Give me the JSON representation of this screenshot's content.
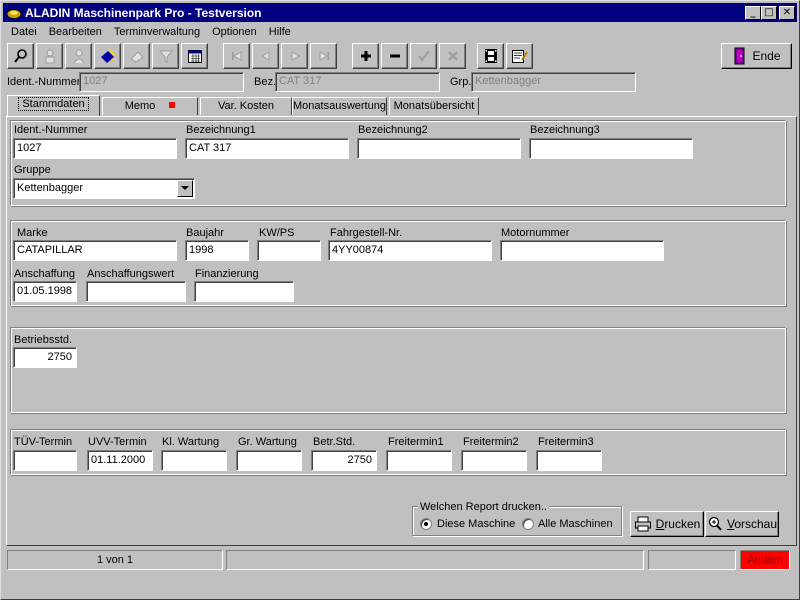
{
  "window": {
    "title": "ALADIN Maschinenpark Pro - Testversion",
    "min_glyph": "_",
    "max_glyph": "□",
    "close_glyph": "✕"
  },
  "menu": [
    {
      "label": "Datei"
    },
    {
      "label": "Bearbeiten"
    },
    {
      "label": "Terminverwaltung"
    },
    {
      "label": "Optionen"
    },
    {
      "label": "Hilfe"
    }
  ],
  "toolbar": {
    "icons": [
      "search-icon",
      "find-person-icon",
      "person-icon",
      "edit-note-icon",
      "eraser-icon",
      "filter-icon",
      "calendar-icon",
      "first-record-icon",
      "previous-record-icon",
      "next-record-icon",
      "last-record-icon",
      "add-icon",
      "remove-icon",
      "confirm-icon",
      "cancel-icon",
      "film-icon",
      "notepad-icon"
    ],
    "ende_label": "Ende"
  },
  "header": {
    "ident_label": "Ident.-Nummer",
    "ident_value": "1027",
    "bez_label": "Bez.",
    "bez_value": "CAT 317",
    "grp_label": "Grp.",
    "grp_value": "Kettenbagger"
  },
  "tabs": [
    {
      "label": "Stammdaten",
      "active": true
    },
    {
      "label": "Memo"
    },
    {
      "label": "Var. Kosten"
    },
    {
      "label": "Monatsauswertung"
    },
    {
      "label": "Monatsübersicht"
    }
  ],
  "stammdaten": {
    "ident_label": "Ident.-Nummer",
    "ident_value": "1027",
    "bez1_label": "Bezeichnung1",
    "bez1_value": "CAT 317",
    "bez2_label": "Bezeichnung2",
    "bez2_value": "",
    "bez3_label": "Bezeichnung3",
    "bez3_value": "",
    "gruppe_label": "Gruppe",
    "gruppe_value": "Kettenbagger",
    "marke_label": "Marke",
    "marke_value": "CATAPILLAR",
    "baujahr_label": "Baujahr",
    "baujahr_value": "1998",
    "kwps_label": "KW/PS",
    "kwps_value": "",
    "fahrgestell_label": "Fahrgestell-Nr.",
    "fahrgestell_value": "4YY00874",
    "motornummer_label": "Motornummer",
    "motornummer_value": "",
    "anschaffung_label": "Anschaffung",
    "anschaffung_value": "01.05.1998",
    "anschaffungswert_label": "Anschaffungswert",
    "anschaffungswert_value": "",
    "finanzierung_label": "Finanzierung",
    "finanzierung_value": "",
    "betriebsstd_label": "Betriebsstd.",
    "betriebsstd_value": "2750",
    "tuev_label": "TÜV-Termin",
    "tuev_value": "",
    "uvv_label": "UVV-Termin",
    "uvv_value": "01.11.2000",
    "klwartung_label": "Kl. Wartung",
    "klwartung_value": "",
    "grwartung_label": "Gr. Wartung",
    "grwartung_value": "",
    "betrstd_label": "Betr.Std.",
    "betrstd_value": "2750",
    "frei1_label": "Freitermin1",
    "frei1_value": "",
    "frei2_label": "Freitermin2",
    "frei2_value": "",
    "frei3_label": "Freitermin3",
    "frei3_value": ""
  },
  "report": {
    "legend": "Welchen Report drucken..",
    "option1": "Diese Maschine",
    "option2": "Alle Maschinen",
    "selected": "Diese Maschine",
    "drucken_label": "Drucken",
    "vorschau_label": "Vorschau"
  },
  "statusbar": {
    "record": "1 von 1",
    "mode": "Ändern"
  },
  "colors": {
    "titlebar": "#000080",
    "face": "#c0c0c0",
    "status_mode": "#ff0000"
  }
}
